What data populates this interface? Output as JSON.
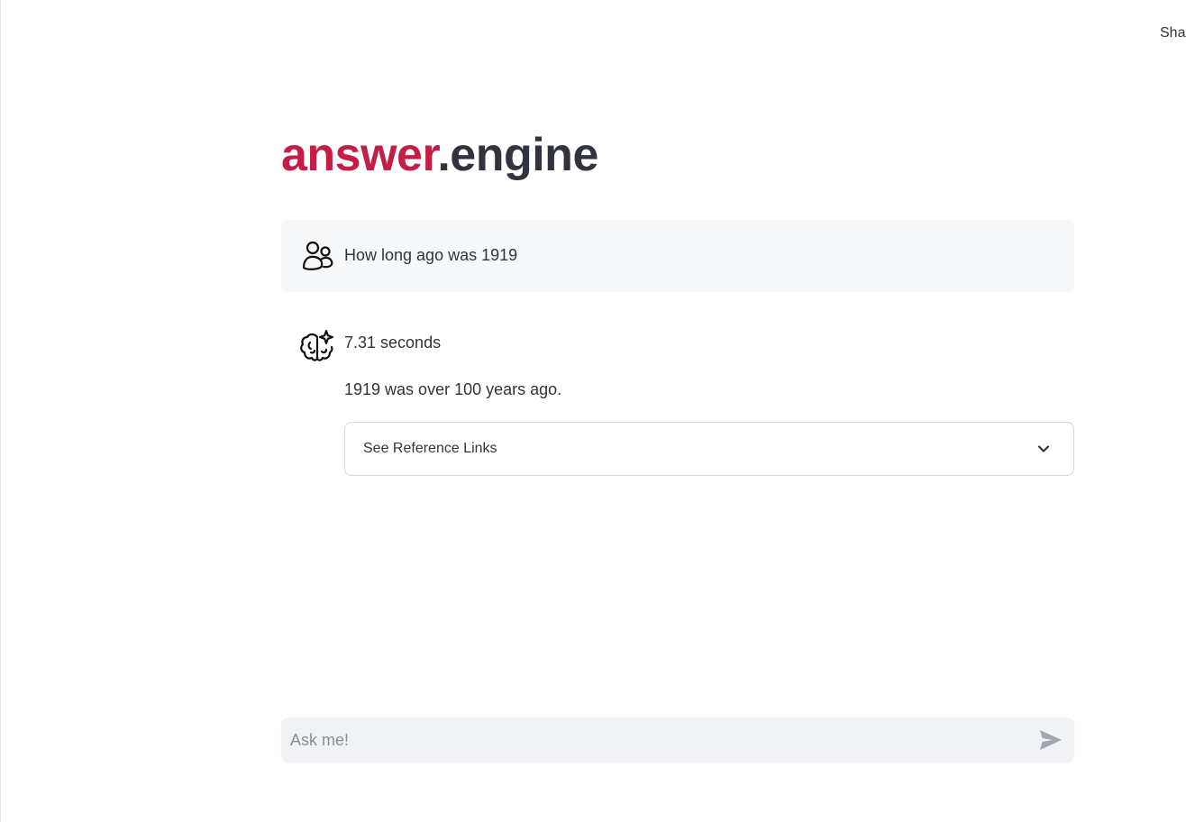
{
  "header": {
    "share_label": "Shar"
  },
  "title": {
    "accent": "answer",
    "rest": ".engine",
    "accent_color": "#c41e46"
  },
  "messages": [
    {
      "role": "user",
      "icon": "users-icon",
      "text": "How long ago was 1919"
    },
    {
      "role": "assistant",
      "icon": "brain-sparkle-icon",
      "elapsed": "7.31 seconds",
      "answer": "1919 was over 100 years ago.",
      "expander_label": "See Reference Links",
      "expander_icon": "chevron-down-icon"
    }
  ],
  "chat_input": {
    "placeholder": "Ask me!",
    "value": "",
    "send_icon": "send-icon"
  }
}
